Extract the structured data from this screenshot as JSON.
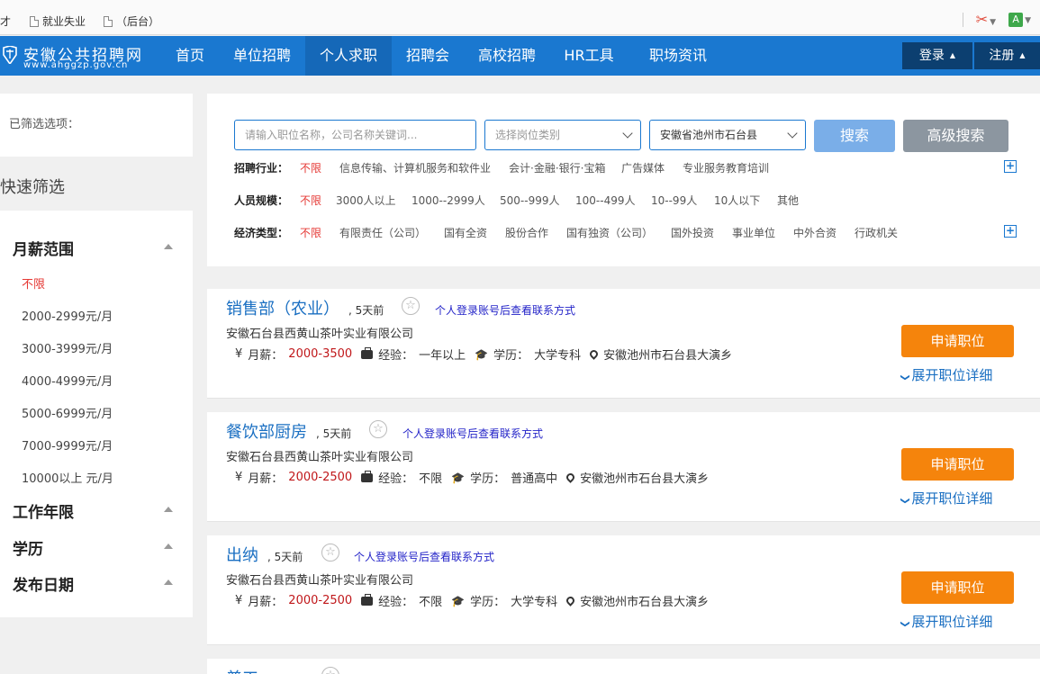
{
  "bookmarks": {
    "items": [
      {
        "label": "人才"
      },
      {
        "label": "就业失业"
      },
      {
        "label": "（后台）"
      }
    ]
  },
  "nav": {
    "logo_title": "安徽公共招聘网",
    "logo_sub": "www.ahggzp.gov.cn",
    "items": [
      "首页",
      "单位招聘",
      "个人求职",
      "招聘会",
      "高校招聘",
      "HR工具",
      "职场资讯"
    ],
    "active_index": 2,
    "login": "登录",
    "register": "注册"
  },
  "sidebar": {
    "filtered_label": "已筛选选项：",
    "quick_title": "快速筛选",
    "sections": [
      {
        "title": "月薪范围",
        "options": [
          "不限",
          "2000-2999元/月",
          "3000-3999元/月",
          "4000-4999元/月",
          "5000-6999元/月",
          "7000-9999元/月",
          "10000以上 元/月"
        ],
        "selected": 0
      },
      {
        "title": "工作年限"
      },
      {
        "title": "学历"
      },
      {
        "title": "发布日期"
      }
    ]
  },
  "search": {
    "keyword_placeholder": "请输入职位名称，公司名称关键词...",
    "category_placeholder": "选择岗位类别",
    "region_value": "安徽省池州市石台县",
    "search_button": "搜索",
    "advanced_button": "高级搜索",
    "filters": [
      {
        "label": "招聘行业：",
        "options": [
          "不限",
          "信息传输、计算机服务和软件业",
          "会计·金融·银行·宝箱",
          "广告媒体",
          "专业服务教育培训"
        ],
        "expandable": true
      },
      {
        "label": "人员规模：",
        "options": [
          "不限",
          "3000人以上",
          "1000--2999人",
          "500--999人",
          "100--499人",
          "10--99人",
          "10人以下",
          "其他"
        ],
        "expandable": false
      },
      {
        "label": "经济类型：",
        "options": [
          "不限",
          "有限责任（公司）",
          "国有全资",
          "股份合作",
          "国有独资（公司）",
          "国外投资",
          "事业单位",
          "中外合资",
          "行政机关"
        ],
        "expandable": true
      }
    ]
  },
  "jobs": [
    {
      "title": "销售部（农业）",
      "age": ", 5天前",
      "login_hint": "个人登录账号后查看联系方式",
      "company": "安徽石台县西黄山茶叶实业有限公司",
      "salary_label": "月薪：",
      "salary": "2000-3500",
      "exp_label": "经验：",
      "experience": "一年以上",
      "edu_label": "学历：",
      "education": "大学专科",
      "location": "安徽池州市石台县大演乡",
      "apply": "申请职位",
      "expand": "展开职位详细"
    },
    {
      "title": "餐饮部厨房",
      "age": ", 5天前",
      "login_hint": "个人登录账号后查看联系方式",
      "company": "安徽石台县西黄山茶叶实业有限公司",
      "salary_label": "月薪：",
      "salary": "2000-2500",
      "exp_label": "经验：",
      "experience": "不限",
      "edu_label": "学历：",
      "education": "普通高中",
      "location": "安徽池州市石台县大演乡",
      "apply": "申请职位",
      "expand": "展开职位详细"
    },
    {
      "title": "出纳",
      "age": ", 5天前",
      "login_hint": "个人登录账号后查看联系方式",
      "company": "安徽石台县西黄山茶叶实业有限公司",
      "salary_label": "月薪：",
      "salary": "2000-2500",
      "exp_label": "经验：",
      "experience": "不限",
      "edu_label": "学历：",
      "education": "大学专科",
      "location": "安徽池州市石台县大演乡",
      "apply": "申请职位",
      "expand": "展开职位详细"
    },
    {
      "title": "普工"
    }
  ]
}
